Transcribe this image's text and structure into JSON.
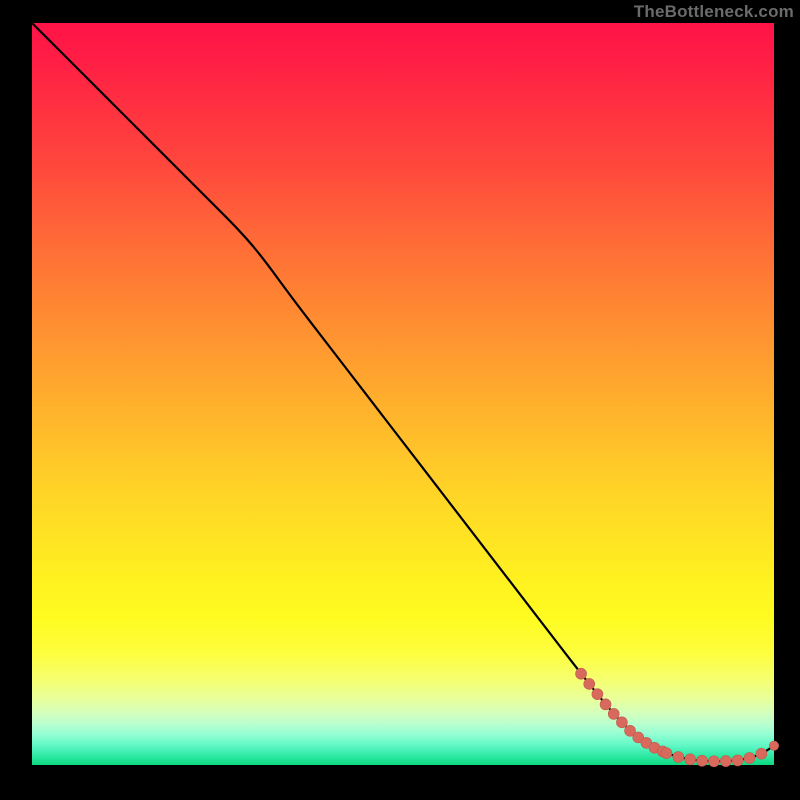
{
  "attribution": "TheBottleneck.com",
  "colors": {
    "page_bg": "#000000",
    "line": "#000000",
    "marker_fill": "#d86a5d",
    "marker_stroke": "#c05a4e"
  },
  "chart_data": {
    "type": "line",
    "title": "",
    "xlabel": "",
    "ylabel": "",
    "xlim": [
      0,
      100
    ],
    "ylim": [
      0,
      100
    ],
    "grid": false,
    "series": [
      {
        "name": "bottleneck-curve",
        "x": [
          0,
          4,
          8,
          12,
          16,
          20,
          24,
          28,
          31,
          35,
          40,
          45,
          50,
          55,
          60,
          65,
          70,
          74,
          78,
          81,
          83.5,
          85.5,
          87,
          89,
          91,
          93,
          95,
          97,
          98.5,
          100
        ],
        "y": [
          100,
          96,
          92,
          88,
          84,
          80,
          76,
          72,
          68.5,
          63,
          56.5,
          50,
          43.5,
          37,
          30.5,
          24,
          17.5,
          12.3,
          7.3,
          4.2,
          2.5,
          1.6,
          1.1,
          0.7,
          0.5,
          0.5,
          0.6,
          1.0,
          1.6,
          2.6
        ]
      }
    ],
    "markers": {
      "name": "highlighted-points",
      "segments": [
        {
          "from_index": 17,
          "to_index": 21,
          "dense_between_step": 1.1
        },
        {
          "from_index": 21,
          "to_index": 28,
          "dense_between_step": 1.6
        }
      ],
      "extra_points": [
        {
          "x": 100,
          "y": 2.6
        }
      ],
      "radius": 5.5
    }
  }
}
